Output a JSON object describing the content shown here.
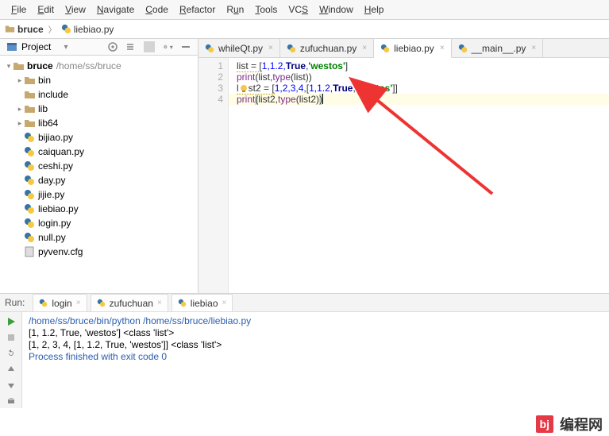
{
  "menu": [
    "File",
    "Edit",
    "View",
    "Navigate",
    "Code",
    "Refactor",
    "Run",
    "Tools",
    "VCS",
    "Window",
    "Help"
  ],
  "breadcrumb": {
    "root": "bruce",
    "file": "liebiao.py"
  },
  "project_header": {
    "label": "Project"
  },
  "tree": {
    "root": {
      "name": "bruce",
      "path": "/home/ss/bruce"
    },
    "folders": [
      "bin",
      "include",
      "lib",
      "lib64"
    ],
    "files": [
      "bijiao.py",
      "caiquan.py",
      "ceshi.py",
      "day.py",
      "jijie.py",
      "liebiao.py",
      "login.py",
      "null.py",
      "pyvenv.cfg"
    ]
  },
  "editor_tabs": [
    {
      "label": "whileQt.py",
      "active": false
    },
    {
      "label": "zufuchuan.py",
      "active": false
    },
    {
      "label": "liebiao.py",
      "active": true
    },
    {
      "label": "__main__.py",
      "active": false
    }
  ],
  "code": {
    "line_numbers": [
      "1",
      "2",
      "3",
      "4"
    ],
    "lines": {
      "l1_pre": "list = [",
      "l1_nums": "1,1.2,",
      "l1_true": "True",
      "l1_sep": ",",
      "l1_str": "'westos'",
      "l1_post": "]",
      "l2_fn": "print",
      "l2_open": "(list,",
      "l2_type": "type",
      "l2_close": "(list))",
      "l3_pre": "l",
      "l3_post": "st2 = [",
      "l3_part1": "1,2,3,4",
      "l3_b1": ",[",
      "l3_part2": "1,1.2,",
      "l3_true": "True",
      "l3_c": ",",
      "l3_str": "'westos'",
      "l3_end": "]]",
      "l4_fn": "print",
      "l4_open": "(",
      "l4_mid": "list2,",
      "l4_type": "type",
      "l4_p2": "(list2)",
      "l4_close": ")"
    }
  },
  "run": {
    "label": "Run:",
    "tabs": [
      {
        "label": "login",
        "active": false
      },
      {
        "label": "zufuchuan",
        "active": false
      },
      {
        "label": "liebiao",
        "active": true
      }
    ],
    "output": {
      "cmd": "/home/ss/bruce/bin/python /home/ss/bruce/liebiao.py",
      "l1": "[1, 1.2, True, 'westos'] <class 'list'>",
      "l2": "[1, 2, 3, 4, [1, 1.2, True, 'westos']] <class 'list'>",
      "l3": "",
      "l4": "Process finished with exit code 0"
    }
  },
  "footer": {
    "logo": "bj",
    "text": "编程网"
  }
}
